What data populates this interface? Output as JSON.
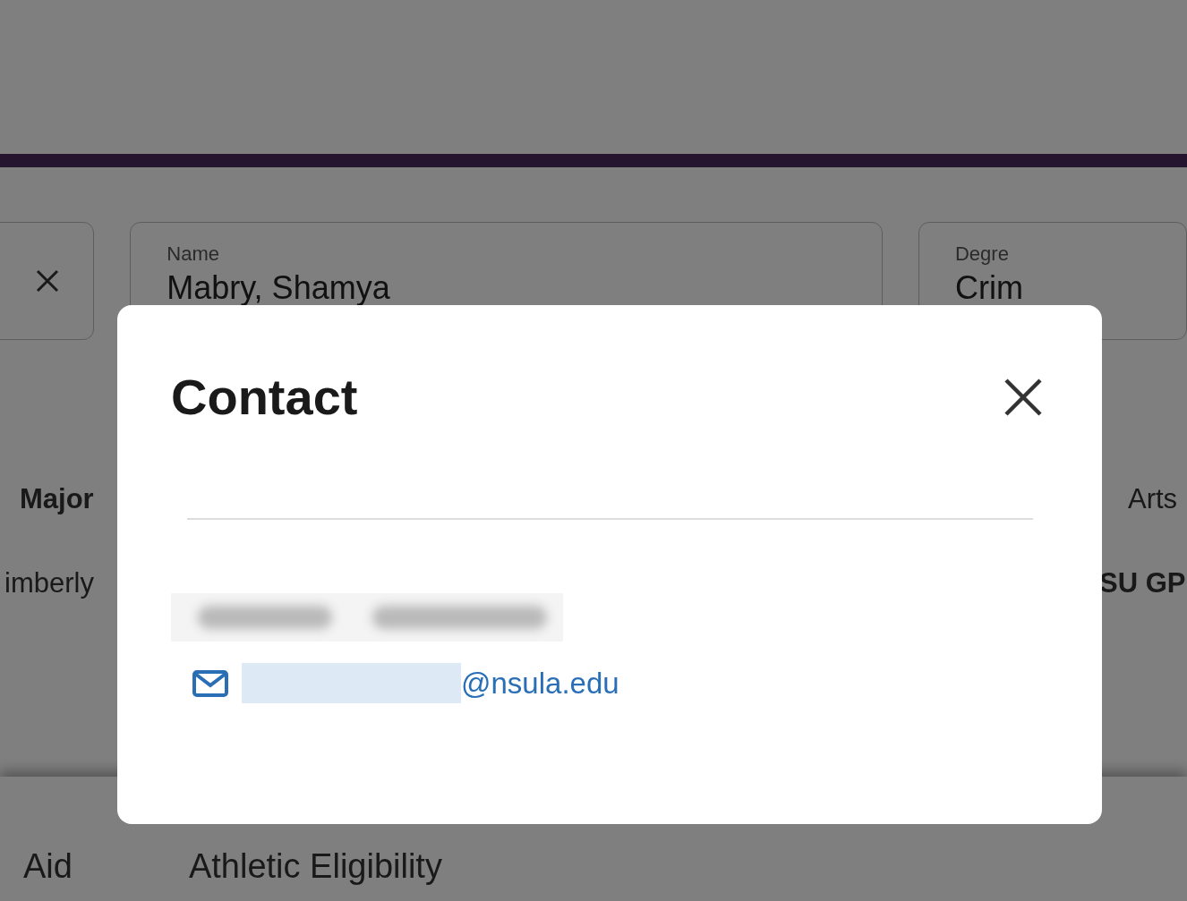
{
  "background": {
    "fields": [
      {
        "label": "Name",
        "value": "Mabry, Shamya"
      },
      {
        "label": "Degre",
        "value": "Crim"
      }
    ],
    "summary": {
      "left": [
        {
          "text": "Major",
          "bold": true
        },
        {
          "text": "imberly",
          "bold": false
        }
      ],
      "right": [
        {
          "text": "Arts",
          "bold": false
        },
        {
          "text": "SU GP",
          "bold": true
        }
      ]
    },
    "tabs": [
      {
        "label": "Aid"
      },
      {
        "label": "Athletic Eligibility"
      }
    ]
  },
  "dialog": {
    "title": "Contact",
    "email": "@nsula.edu"
  }
}
